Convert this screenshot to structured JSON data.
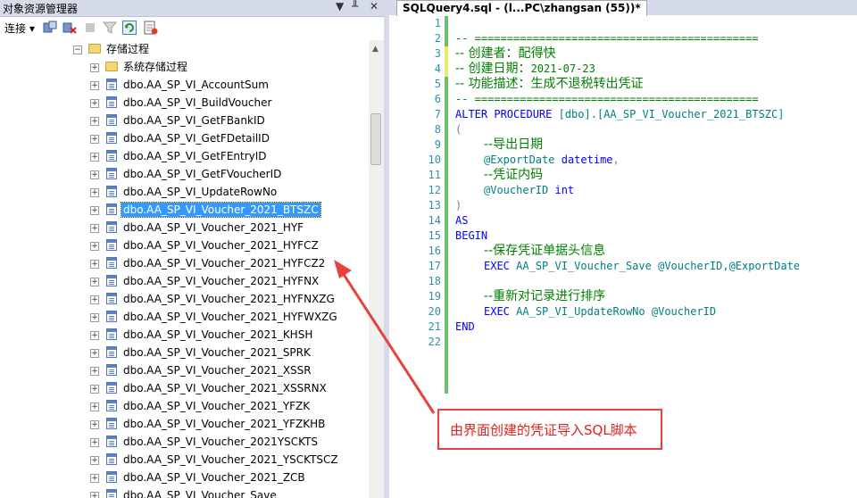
{
  "object_explorer": {
    "title": "对象资源管理器",
    "pin_glyph": "▾ ㅍ ✕",
    "toolbar": {
      "connect_label": "连接 ▾"
    },
    "folder_label": "存储过程",
    "system_folder_label": "系统存储过程",
    "procedures": [
      "dbo.AA_SP_VI_AccountSum",
      "dbo.AA_SP_VI_BuildVoucher",
      "dbo.AA_SP_VI_GetFBankID",
      "dbo.AA_SP_VI_GetFDetailID",
      "dbo.AA_SP_VI_GetFEntryID",
      "dbo.AA_SP_VI_GetFVoucherID",
      "dbo.AA_SP_VI_UpdateRowNo",
      "dbo.AA_SP_VI_Voucher_2021_BTSZC",
      "dbo.AA_SP_VI_Voucher_2021_HYF",
      "dbo.AA_SP_VI_Voucher_2021_HYFCZ",
      "dbo.AA_SP_VI_Voucher_2021_HYFCZ2",
      "dbo.AA_SP_VI_Voucher_2021_HYFNX",
      "dbo.AA_SP_VI_Voucher_2021_HYFNXZG",
      "dbo.AA_SP_VI_Voucher_2021_HYFWXZG",
      "dbo.AA_SP_VI_Voucher_2021_KHSH",
      "dbo.AA_SP_VI_Voucher_2021_SPRK",
      "dbo.AA_SP_VI_Voucher_2021_XSSR",
      "dbo.AA_SP_VI_Voucher_2021_XSSRNX",
      "dbo.AA_SP_VI_Voucher_2021_YFZK",
      "dbo.AA_SP_VI_Voucher_2021_YFZKHB",
      "dbo.AA_SP_VI_Voucher_2021YSCKTS",
      "dbo.AA_SP_VI_Voucher_2021_YSCKTSCZ",
      "dbo.AA_SP_VI_Voucher_2021_ZCB",
      "dbo.AA_SP_VI_Voucher_Save"
    ],
    "selected_index": 7
  },
  "editor": {
    "tab_title": "SQLQuery4.sql - (l...PC\\zhangsan (55))*",
    "line_numbers": [
      "1",
      "2",
      "3",
      "4",
      "5",
      "6",
      "7",
      "8",
      "9",
      "10",
      "11",
      "12",
      "13",
      "14",
      "15",
      "16",
      "17",
      "18",
      "19",
      "20",
      "21",
      "22"
    ],
    "code": {
      "l2": "-- ============================================",
      "l3": "-- 创建者：配得快",
      "l4a": "-- 创建日期：",
      "l4b": "2021-07-23",
      "l5": "-- 功能描述：生成不退税转出凭证",
      "l6": "-- ============================================",
      "l7_kw1": "ALTER PROCEDURE",
      "l7_rest": "[dbo].[AA_SP_VI_Voucher_2021_BTSZC]",
      "l8": "(",
      "l9": "--导出日期",
      "l10_var": "@ExportDate",
      "l10_type": "datetime",
      "l10_punct": ",",
      "l11": "--凭证内码",
      "l12_var": "@VoucherID",
      "l12_type": "int",
      "l13": ")",
      "l14": "AS",
      "l15": "BEGIN",
      "l16": "--保存凭证单据头信息",
      "l17_kw": "EXEC",
      "l17_proc": "AA_SP_VI_Voucher_Save",
      "l17_args": "@VoucherID,@ExportDate",
      "l19": "--重新对记录进行排序",
      "l20_kw": "EXEC",
      "l20_proc": "AA_SP_VI_UpdateRowNo",
      "l20_args": "@VoucherID",
      "l21": "END"
    }
  },
  "annotation": {
    "text": "由界面创建的凭证导入SQL脚本",
    "color": "#e64340"
  }
}
